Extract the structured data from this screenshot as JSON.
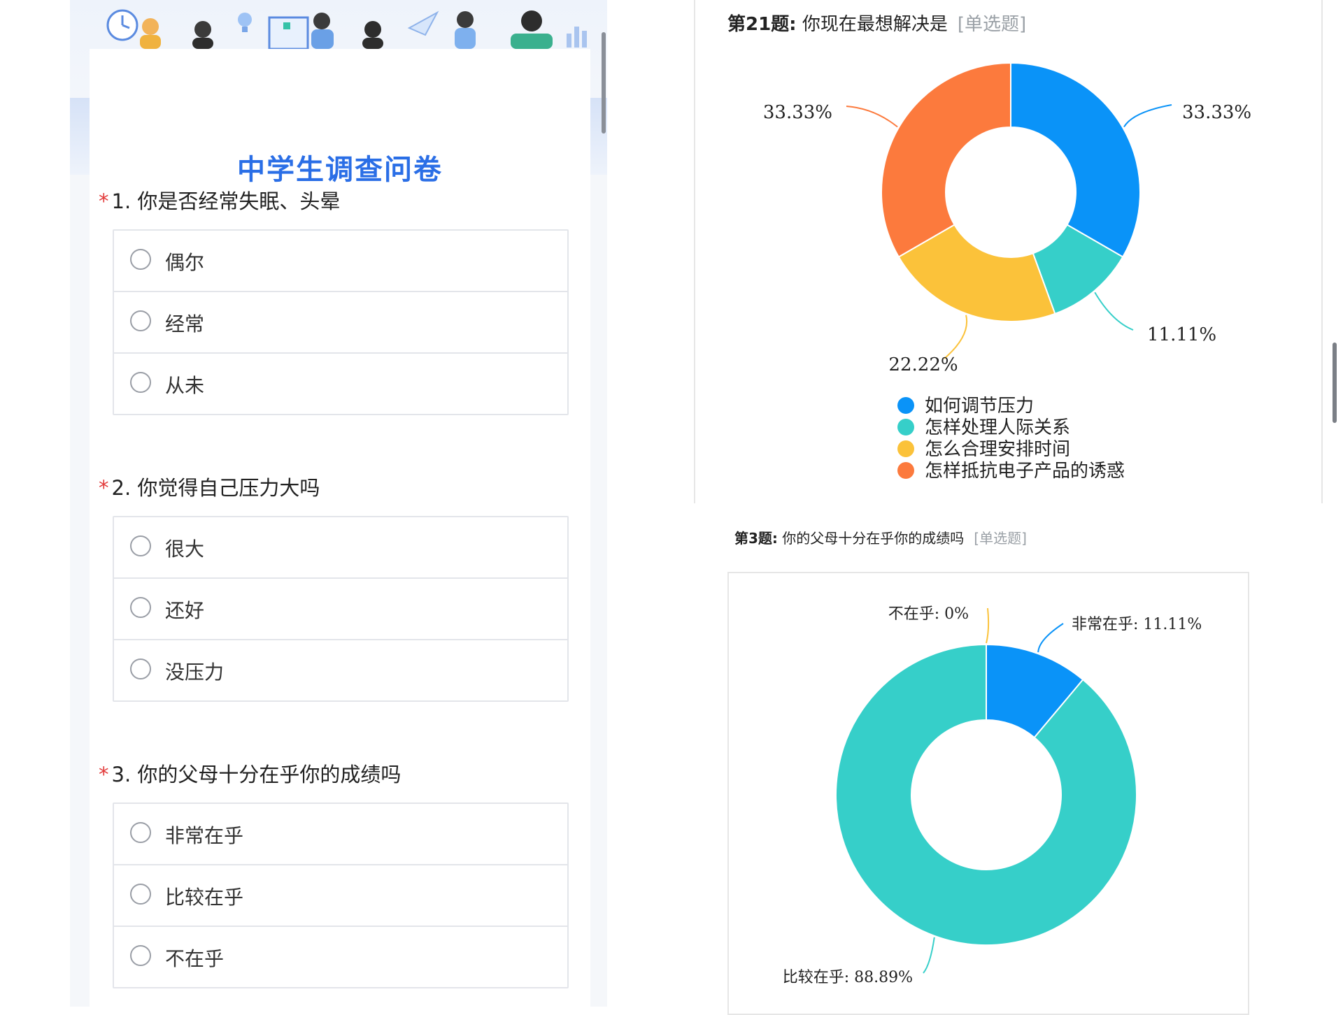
{
  "survey": {
    "title": "中学生调查问卷",
    "questions": [
      {
        "required_mark": "*",
        "text": "1. 你是否经常失眠、头晕",
        "options": [
          "偶尔",
          "经常",
          "从未"
        ]
      },
      {
        "required_mark": "*",
        "text": "2. 你觉得自己压力大吗",
        "options": [
          "很大",
          "还好",
          "没压力"
        ]
      },
      {
        "required_mark": "*",
        "text": "3. 你的父母十分在乎你的成绩吗",
        "options": [
          "非常在乎",
          "比较在乎",
          "不在乎"
        ]
      }
    ]
  },
  "charts_header": {
    "q21": {
      "num": "第21题:",
      "title": "你现在最想解决是",
      "tag": "[单选题]"
    },
    "q3": {
      "num": "第3题:",
      "title": "你的父母十分在乎你的成绩吗",
      "tag": "[单选题]"
    }
  },
  "chart_data": [
    {
      "type": "pie",
      "title": "第21题: 你现在最想解决是",
      "series": [
        {
          "name": "如何调节压力",
          "value": 33.33,
          "label": "33.33%",
          "color": "#0a93f8"
        },
        {
          "name": "怎样处理人际关系",
          "value": 11.11,
          "label": "11.11%",
          "color": "#36cfc9"
        },
        {
          "name": "怎么合理安排时间",
          "value": 22.22,
          "label": "22.22%",
          "color": "#fbc23a"
        },
        {
          "name": "怎样抵抗电子产品的诱惑",
          "value": 33.33,
          "label": "33.33%",
          "color": "#fc7a3d"
        }
      ],
      "legend": "bottom-center"
    },
    {
      "type": "pie",
      "title": "第3题: 你的父母十分在乎你的成绩吗",
      "series": [
        {
          "name": "非常在乎",
          "value": 11.11,
          "label": "非常在乎: 11.11%",
          "color": "#0a93f8"
        },
        {
          "name": "比较在乎",
          "value": 88.89,
          "label": "比较在乎: 88.89%",
          "color": "#36cfc9"
        },
        {
          "name": "不在乎",
          "value": 0,
          "label": "不在乎: 0%",
          "color": "#fbc23a"
        }
      ],
      "legend": "none"
    }
  ]
}
